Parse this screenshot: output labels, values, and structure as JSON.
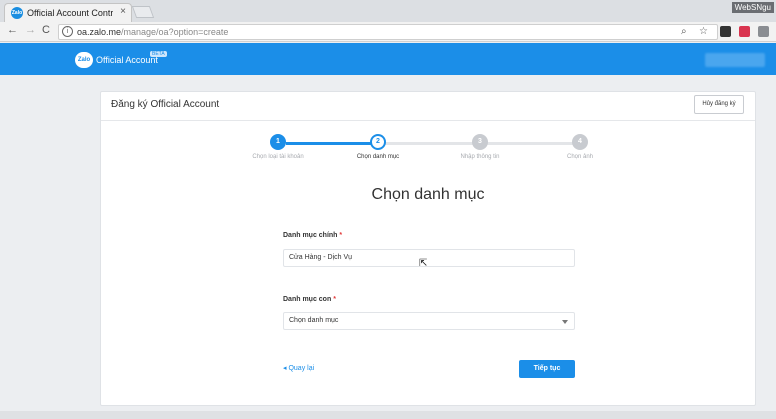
{
  "browser": {
    "tab_title": "Official Account Control",
    "tab_close": "×",
    "window_user": "WebSNgu",
    "url_host": "oa.zalo.me",
    "url_path": "/manage/oa?option=create",
    "info_glyph": "i"
  },
  "header": {
    "logo_text": "Zalo",
    "brand": "Official Account",
    "beta": "BETA"
  },
  "card": {
    "title": "Đăng ký Official Account",
    "cancel_label": "Hủy đăng ký"
  },
  "stepper": {
    "steps": [
      {
        "number": "1",
        "label": "Chọn loại tài khoản",
        "state": "done"
      },
      {
        "number": "2",
        "label": "Chọn danh mục",
        "state": "active"
      },
      {
        "number": "3",
        "label": "Nhập thông tin",
        "state": "pending"
      },
      {
        "number": "4",
        "label": "Chọn ảnh",
        "state": "pending"
      }
    ]
  },
  "form": {
    "section_title": "Chọn danh mục",
    "main_category_label": "Danh mục chính",
    "main_category_value": "Cửa Hàng - Dịch Vụ",
    "sub_category_label": "Danh mục con",
    "sub_category_value": "Chọn danh mục",
    "required_mark": "*",
    "back_label": "◂ Quay lại",
    "next_label": "Tiếp tục"
  },
  "colors": {
    "brand_blue": "#1b8ee8",
    "step_pending": "#c8cbd0",
    "required_red": "#e23b3b"
  }
}
